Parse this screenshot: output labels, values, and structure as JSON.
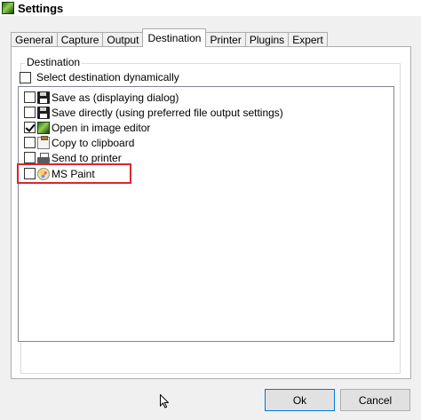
{
  "window": {
    "title": "Settings",
    "icon": "greenshot-app-icon"
  },
  "tabs": [
    {
      "label": "General",
      "active": false
    },
    {
      "label": "Capture",
      "active": false
    },
    {
      "label": "Output",
      "active": false
    },
    {
      "label": "Destination",
      "active": true
    },
    {
      "label": "Printer",
      "active": false
    },
    {
      "label": "Plugins",
      "active": false
    },
    {
      "label": "Expert",
      "active": false
    }
  ],
  "destination": {
    "group_label": "Destination",
    "dynamic_label": "Select destination dynamically",
    "dynamic_checked": false,
    "items": [
      {
        "label": "Save as (displaying dialog)",
        "checked": false,
        "icon": "floppy-disk-icon"
      },
      {
        "label": "Save directly (using preferred file output settings)",
        "checked": false,
        "icon": "floppy-disk-icon"
      },
      {
        "label": "Open in image editor",
        "checked": true,
        "icon": "image-editor-icon"
      },
      {
        "label": "Copy to clipboard",
        "checked": false,
        "icon": "clipboard-icon"
      },
      {
        "label": "Send to printer",
        "checked": false,
        "icon": "printer-icon"
      },
      {
        "label": "MS Paint",
        "checked": false,
        "icon": "ms-paint-icon"
      }
    ],
    "highlight_color": "#d9262f"
  },
  "buttons": {
    "ok": "Ok",
    "cancel": "Cancel"
  }
}
